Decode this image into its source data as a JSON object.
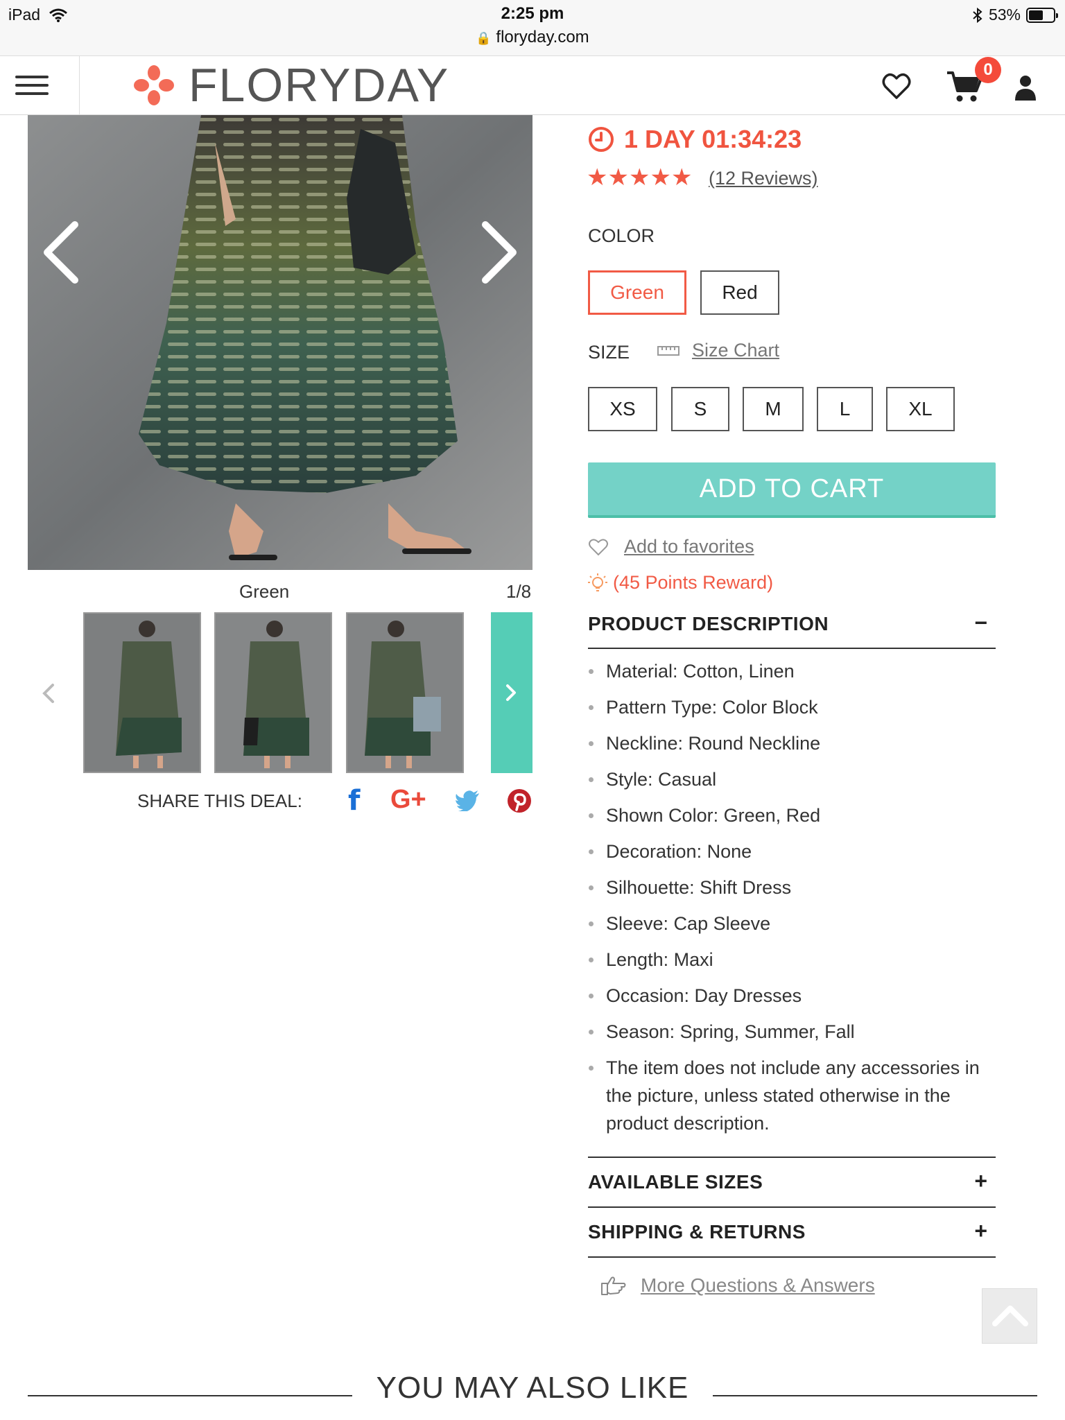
{
  "status_bar": {
    "device": "iPad",
    "time": "2:25 pm",
    "url": "floryday.com",
    "battery": "53%"
  },
  "header": {
    "brand": "FLORYDAY",
    "cart_count": "0",
    "icons": [
      "menu-icon",
      "heart-icon",
      "cart-icon",
      "user-icon"
    ]
  },
  "gallery": {
    "color_caption": "Green",
    "counter": "1/8",
    "thumbnails": [
      "thumb-1",
      "thumb-2",
      "thumb-3"
    ]
  },
  "share": {
    "label": "SHARE THIS DEAL:",
    "facebook": "f",
    "googleplus": "G+",
    "colors": {
      "facebook": "#1a6fd6",
      "googleplus": "#ea4a3b",
      "twitter": "#5ab3e6",
      "pinterest": "#c1232a"
    }
  },
  "product": {
    "countdown": "1 DAY 01:34:23",
    "rating": 5,
    "reviews_link": "(12 Reviews)",
    "color_label": "COLOR",
    "colors": [
      "Green",
      "Red"
    ],
    "selected_color": "Green",
    "size_label": "SIZE",
    "size_chart_link": "Size Chart",
    "sizes": [
      "XS",
      "S",
      "M",
      "L",
      "XL"
    ],
    "add_to_cart": "ADD TO CART",
    "add_to_favorites": "Add to favorites",
    "points_reward": "(45 Points Reward)",
    "accent_color": "#f15a45",
    "cart_button_color": "#74d2c7"
  },
  "description": {
    "title": "PRODUCT DESCRIPTION",
    "toggle": "−",
    "items": [
      "Material: Cotton, Linen",
      "Pattern Type: Color Block",
      "Neckline: Round Neckline",
      "Style: Casual",
      "Shown Color: Green, Red",
      "Decoration: None",
      "Silhouette: Shift Dress",
      "Sleeve: Cap Sleeve",
      "Length: Maxi",
      "Occasion: Day Dresses",
      "Season: Spring, Summer, Fall",
      "The item does not include any accessories in the picture, unless stated otherwise in the product description."
    ]
  },
  "sections": {
    "available_sizes": "AVAILABLE SIZES",
    "shipping_returns": "SHIPPING & RETURNS",
    "expand": "+"
  },
  "more_qa": "More Questions & Answers",
  "also_like": "YOU MAY ALSO LIKE"
}
